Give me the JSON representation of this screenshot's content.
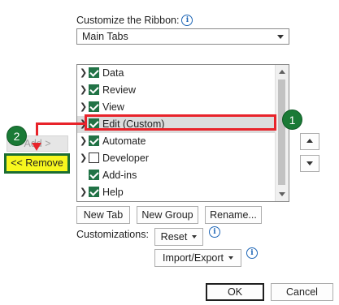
{
  "header": {
    "title": "Customize the Ribbon:"
  },
  "tabs_select": {
    "value": "Main Tabs"
  },
  "tree": {
    "items": [
      {
        "label": "Data",
        "checked": true
      },
      {
        "label": "Review",
        "checked": true
      },
      {
        "label": "View",
        "checked": true
      },
      {
        "label": "Edit (Custom)",
        "checked": true
      },
      {
        "label": "Automate",
        "checked": true
      },
      {
        "label": "Developer",
        "checked": false
      },
      {
        "label": "Add-ins",
        "checked": true
      },
      {
        "label": "Help",
        "checked": true
      }
    ]
  },
  "left": {
    "add_label": "Add >",
    "remove_label": "<< Remove"
  },
  "buttons": {
    "new_tab": "New Tab",
    "new_group": "New Group",
    "rename": "Rename...",
    "customizations_label": "Customizations:",
    "reset": "Reset",
    "import_export": "Import/Export",
    "ok": "OK",
    "cancel": "Cancel"
  },
  "annotations": {
    "step1": "1",
    "step2": "2"
  },
  "colors": {
    "highlight": "#e8232a",
    "badge": "#1a7a36",
    "remove_bg": "#f7f71e",
    "checkbox": "#217346"
  },
  "icons": [
    "info-icon",
    "chevron-right-icon",
    "checkbox-icon",
    "scroll-up-icon",
    "scroll-down-icon",
    "move-up-icon",
    "move-down-icon",
    "dropdown-arrow-icon"
  ]
}
